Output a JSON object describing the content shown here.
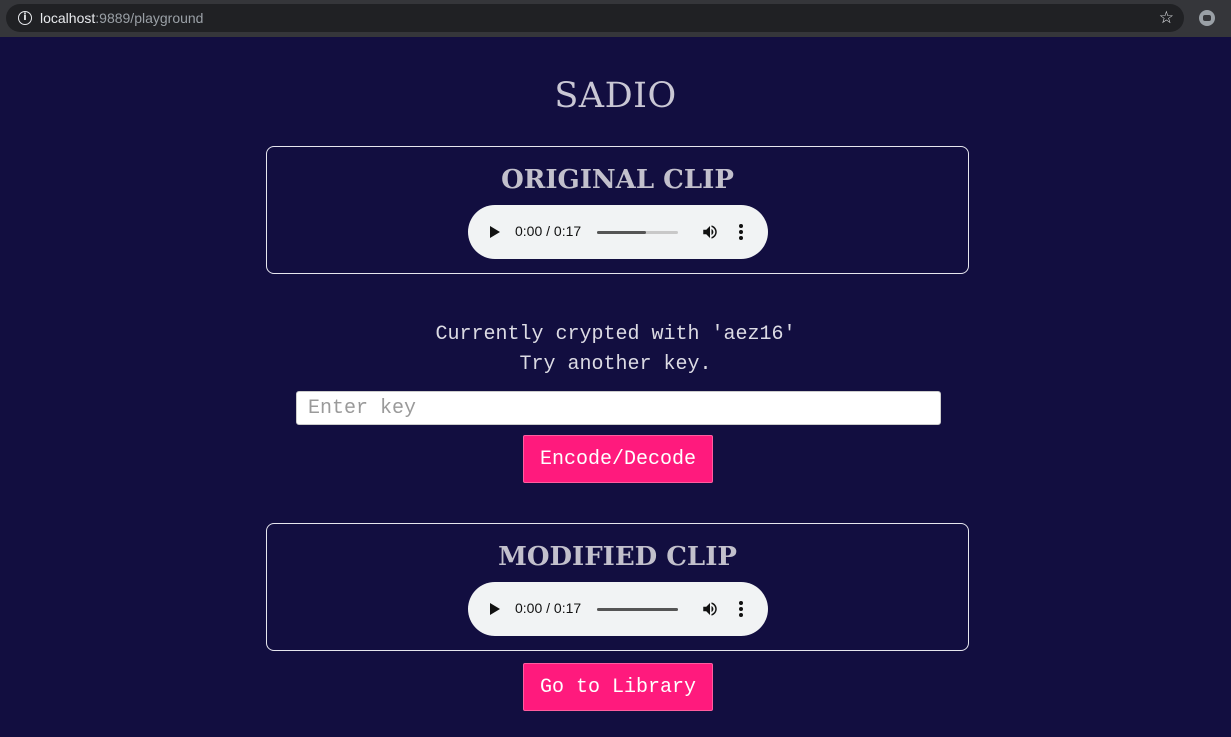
{
  "browser": {
    "url_host": "localhost",
    "url_path": ":9889/playground"
  },
  "page": {
    "title": "SADIO"
  },
  "original_clip": {
    "heading": "ORIGINAL CLIP",
    "time": "0:00 / 0:17",
    "volume_level": 0.6
  },
  "status": {
    "line1": "Currently crypted with 'aez16'",
    "line2": "Try another key."
  },
  "key_input": {
    "placeholder": "Enter key",
    "value": ""
  },
  "encode_button": {
    "label": "Encode/Decode"
  },
  "modified_clip": {
    "heading": "MODIFIED CLIP",
    "time": "0:00 / 0:17",
    "volume_level": 1.0
  },
  "library_button": {
    "label": "Go to Library"
  },
  "colors": {
    "background": "#120e40",
    "accent": "#ff1a7d"
  }
}
